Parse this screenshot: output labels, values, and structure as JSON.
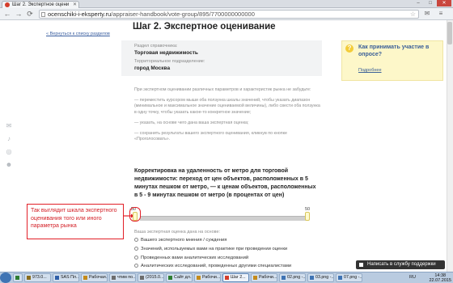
{
  "browser": {
    "tab_title": "Шаг 2. Экспертное оцени",
    "url_domain": "ocenschiki-i-eksperty.ru",
    "url_path": "/appraiser-handbook/vote-group/895/7700000000000",
    "window_buttons": [
      "–",
      "□",
      "✕"
    ]
  },
  "page": {
    "back_link": "« Вернуться к списку разделов",
    "title": "Шаг 2. Экспертное оценивание",
    "section_label": "Раздел справочника:",
    "section_value": "Торговая недвижимость",
    "territory_label": "Территориальное подразделение:",
    "territory_value": "город Москва",
    "intro": [
      "При экспертном оценивании различных параметров и характеристик рынка не забудьте:",
      "— переместить курсором мыши оба ползунка шкалы значений, чтобы указать диапазон (минимальное и максимальное значение оцениваемой величины), либо свести оба ползунка в одну точку, чтобы указать какое-то конкретное значение;",
      "— указать, на основе чего дана ваша экспертная оценка;",
      "— сохранить результаты вашего экспертного оценивания, кликнув по кнопке «Проголосовать»."
    ],
    "question_heading": "Корректировка на удаленность от метро для торговой недвижимости: переход от цен объектов, расположенных в 5 минутах пешком от метро, — к ценам объектов, расположенных в 5 - 9 минутах пешком от метро (в процентах от цен)",
    "help_box": {
      "icon": "?",
      "title": "Как принимать участие в опросе?",
      "more_link": "Подробнее"
    },
    "annotation": "Так выглядит шкала экспертного оценивания того или иного параметра рынка",
    "slider": {
      "min_label": "-50",
      "max_label": "50",
      "min_value": -50,
      "max_value": 50
    },
    "basis_label": "Ваша экспертная оценка дана на основе:",
    "basis_options": [
      "Вашего экспертного мнения / суждения",
      "Значений, используемых вами на практике при проведении оценки",
      "Проведенных вами аналитических исследований",
      "Аналитических исследований, проведенных другими специалистами"
    ],
    "feedback_button": "Написать в службу поддержки"
  },
  "taskbar": {
    "items": [
      "",
      "973.0...",
      "SAS Пл...",
      "Рабочая...",
      "чтим по...",
      "(2015.0...",
      "Сайт дл...",
      "Рабочи...",
      "Шаг 2...",
      "Рабочи...",
      "02.png -...",
      "03.png -...",
      "07.png -..."
    ],
    "active_index": 8,
    "lang": "RU",
    "time": "14:38",
    "date": "22.07.2015"
  },
  "colors": {
    "link": "#3b5fa0",
    "annotation_red": "#e21f27",
    "help_box_bg": "#fdf7c9"
  }
}
